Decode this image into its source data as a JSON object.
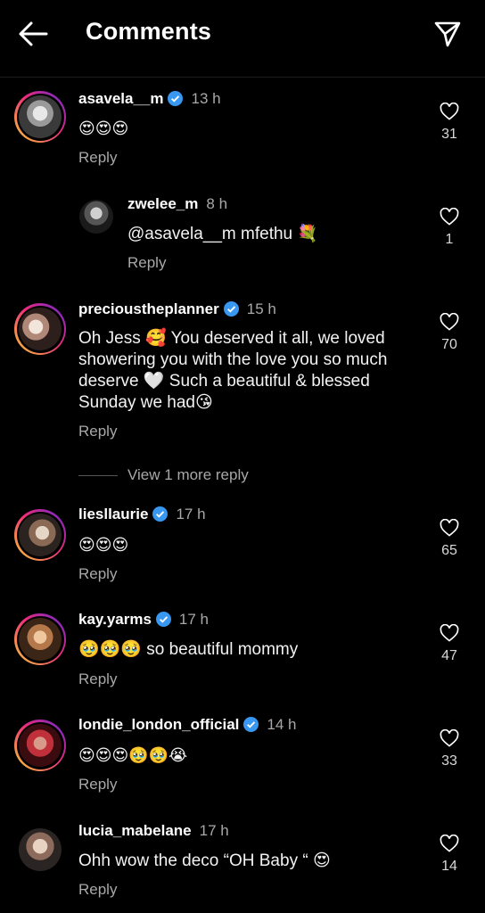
{
  "header": {
    "title": "Comments"
  },
  "comments": [
    {
      "username": "asavela__m",
      "verified": true,
      "time": "13 h",
      "text": "😍😍😍",
      "likes": "31",
      "reply": "Reply"
    },
    {
      "username": "zwelee_m",
      "verified": false,
      "time": "8 h",
      "text": "@asavela__m mfethu 💐",
      "likes": "1",
      "reply": "Reply"
    },
    {
      "username": "precioustheplanner",
      "verified": true,
      "time": "15 h",
      "text": "Oh Jess 🥰 You deserved it all, we loved showering you with the love you so much deserve 🤍 Such a beautiful & blessed Sunday we had😘",
      "likes": "70",
      "reply": "Reply"
    },
    {
      "username": "liesllaurie",
      "verified": true,
      "time": "17 h",
      "text": "😍😍😍",
      "likes": "65",
      "reply": "Reply"
    },
    {
      "username": "kay.yarms",
      "verified": true,
      "time": "17 h",
      "text": "🥹🥹🥹 so beautiful mommy",
      "likes": "47",
      "reply": "Reply"
    },
    {
      "username": "londie_london_official",
      "verified": true,
      "time": "14 h",
      "text": "😍😍😍🥹🥹😭",
      "likes": "33",
      "reply": "Reply"
    },
    {
      "username": "lucia_mabelane",
      "verified": false,
      "time": "17 h",
      "text": "Ohh wow the deco “OH Baby “ 😍",
      "likes": "14",
      "reply": "Reply"
    }
  ],
  "view_more": "View 1 more reply",
  "colors": {
    "background": "#000000",
    "verified": "#3897f0",
    "secondary_text": "#a8a8a8"
  },
  "icons": [
    "back-arrow-icon",
    "send-icon",
    "verified-badge-icon",
    "heart-icon"
  ]
}
